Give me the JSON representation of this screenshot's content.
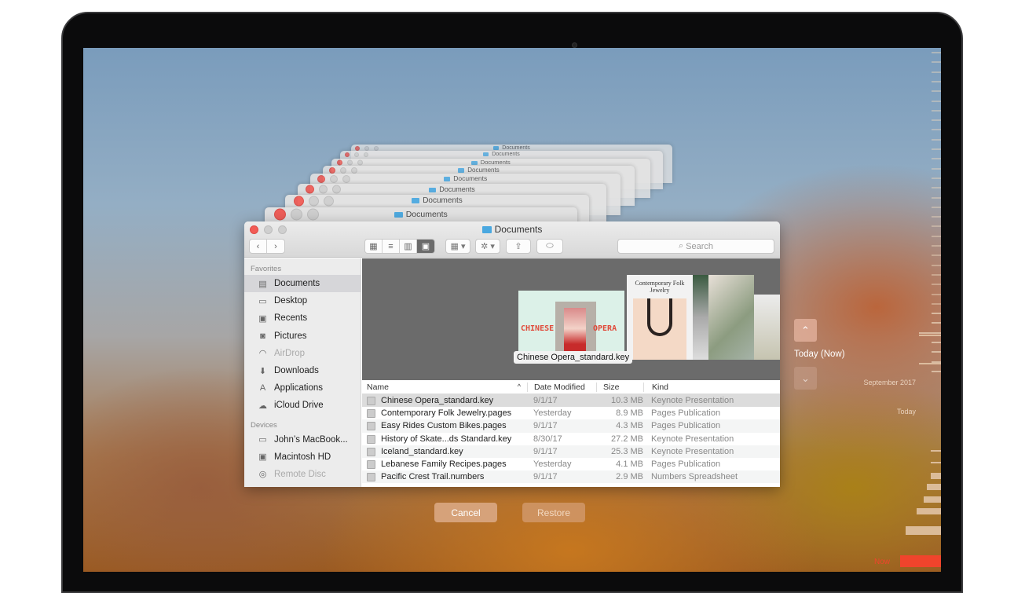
{
  "window": {
    "title": "Documents",
    "stack_titles": [
      "Documents",
      "Documents",
      "Documents",
      "Documents",
      "Documents",
      "Documents",
      "Documents",
      "Documents"
    ]
  },
  "toolbar": {
    "search_placeholder": "Search",
    "view_modes": [
      "icon",
      "list",
      "column",
      "cover-flow"
    ],
    "active_view": "cover-flow"
  },
  "sidebar": {
    "favorites_header": "Favorites",
    "favorites": [
      {
        "label": "Documents",
        "icon": "documents-icon",
        "selected": true
      },
      {
        "label": "Desktop",
        "icon": "desktop-icon"
      },
      {
        "label": "Recents",
        "icon": "recents-icon"
      },
      {
        "label": "Pictures",
        "icon": "camera-icon"
      },
      {
        "label": "AirDrop",
        "icon": "airdrop-icon",
        "dimmed": true
      },
      {
        "label": "Downloads",
        "icon": "downloads-icon"
      },
      {
        "label": "Applications",
        "icon": "applications-icon"
      },
      {
        "label": "iCloud Drive",
        "icon": "cloud-icon"
      }
    ],
    "devices_header": "Devices",
    "devices": [
      {
        "label": "John’s MacBook...",
        "icon": "laptop-icon"
      },
      {
        "label": "Macintosh HD",
        "icon": "disk-icon"
      },
      {
        "label": "Remote Disc",
        "icon": "disc-icon",
        "dimmed": true
      }
    ]
  },
  "preview": {
    "caption": "Chinese Opera_standard.key",
    "cover1_left": "CHINESE",
    "cover1_right": "OPERA",
    "cover2_title": "Contemporary Folk Jewelry"
  },
  "list": {
    "columns": [
      "Name",
      "Date Modified",
      "Size",
      "Kind"
    ],
    "rows": [
      {
        "name": "Chinese Opera_standard.key",
        "date": "9/1/17",
        "size": "10.3 MB",
        "kind": "Keynote Presentation",
        "selected": true
      },
      {
        "name": "Contemporary Folk Jewelry.pages",
        "date": "Yesterday",
        "size": "8.9 MB",
        "kind": "Pages Publication"
      },
      {
        "name": "Easy Rides Custom Bikes.pages",
        "date": "9/1/17",
        "size": "4.3 MB",
        "kind": "Pages Publication"
      },
      {
        "name": "History of Skate...ds Standard.key",
        "date": "8/30/17",
        "size": "27.2 MB",
        "kind": "Keynote Presentation"
      },
      {
        "name": "Iceland_standard.key",
        "date": "9/1/17",
        "size": "25.3 MB",
        "kind": "Keynote Presentation"
      },
      {
        "name": "Lebanese Family Recipes.pages",
        "date": "Yesterday",
        "size": "4.1 MB",
        "kind": "Pages Publication"
      },
      {
        "name": "Pacific Crest Trail.numbers",
        "date": "9/1/17",
        "size": "2.9 MB",
        "kind": "Numbers Spreadsheet"
      }
    ]
  },
  "buttons": {
    "cancel": "Cancel",
    "restore": "Restore"
  },
  "timeline": {
    "current": "Today (Now)",
    "labels": {
      "month": "September 2017",
      "today": "Today",
      "now": "Now"
    },
    "now_color": "#f0442c"
  }
}
